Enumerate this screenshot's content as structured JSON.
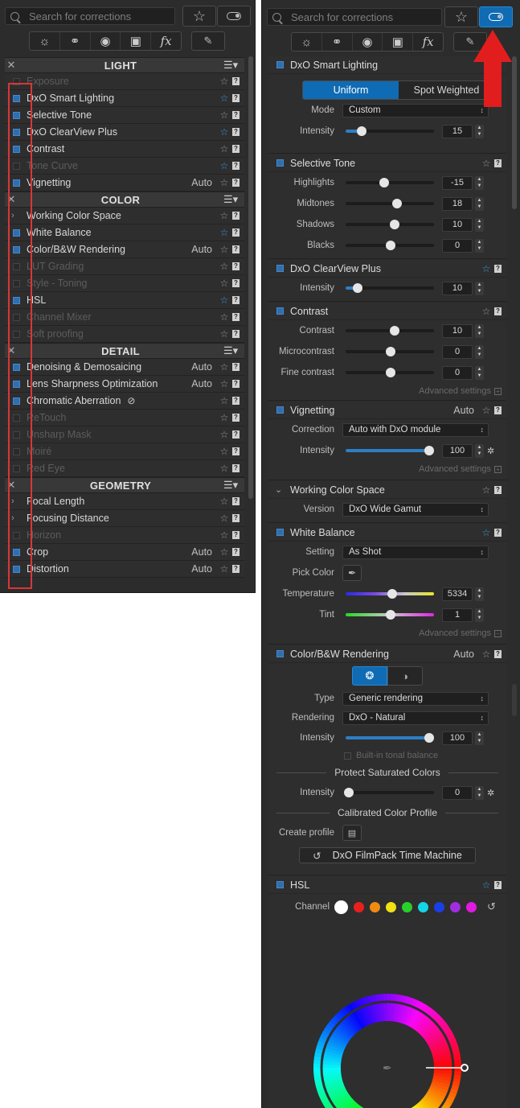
{
  "left": {
    "search_placeholder": "Search for corrections",
    "sections": [
      {
        "title": "LIGHT",
        "rows": [
          {
            "label": "Exposure",
            "state": "off",
            "dim": true,
            "auto": "",
            "star": false
          },
          {
            "label": "DxO Smart Lighting",
            "state": "on",
            "dim": false,
            "auto": "",
            "star": true
          },
          {
            "label": "Selective Tone",
            "state": "on",
            "dim": false,
            "auto": "",
            "star": false
          },
          {
            "label": "DxO ClearView Plus",
            "state": "on",
            "dim": false,
            "auto": "",
            "star": true
          },
          {
            "label": "Contrast",
            "state": "on",
            "dim": false,
            "auto": "",
            "star": false
          },
          {
            "label": "Tone Curve",
            "state": "off",
            "dim": true,
            "auto": "",
            "star": true
          },
          {
            "label": "Vignetting",
            "state": "on",
            "dim": false,
            "auto": "Auto",
            "star": false
          }
        ]
      },
      {
        "title": "COLOR",
        "rows": [
          {
            "label": "Working Color Space",
            "state": "chev",
            "dim": false,
            "auto": "",
            "star": false
          },
          {
            "label": "White Balance",
            "state": "on",
            "dim": false,
            "auto": "",
            "star": true
          },
          {
            "label": "Color/B&W Rendering",
            "state": "on",
            "dim": false,
            "auto": "Auto",
            "star": false
          },
          {
            "label": "LUT Grading",
            "state": "off",
            "dim": true,
            "auto": "",
            "star": false
          },
          {
            "label": "Style - Toning",
            "state": "off",
            "dim": true,
            "auto": "",
            "star": false
          },
          {
            "label": "HSL",
            "state": "on",
            "dim": false,
            "auto": "",
            "star": true
          },
          {
            "label": "Channel Mixer",
            "state": "off",
            "dim": true,
            "auto": "",
            "star": false
          },
          {
            "label": "Soft proofing",
            "state": "off",
            "dim": true,
            "auto": "",
            "star": false
          }
        ]
      },
      {
        "title": "DETAIL",
        "rows": [
          {
            "label": "Denoising & Demosaicing",
            "state": "on",
            "dim": false,
            "auto": "Auto",
            "star": false
          },
          {
            "label": "Lens Sharpness Optimization",
            "state": "on",
            "dim": false,
            "auto": "Auto",
            "star": false
          },
          {
            "label": "Chromatic Aberration",
            "state": "on",
            "dim": false,
            "auto": "",
            "star": false,
            "eye": true
          },
          {
            "label": "ReTouch",
            "state": "off",
            "dim": true,
            "auto": "",
            "star": false
          },
          {
            "label": "Unsharp Mask",
            "state": "off",
            "dim": true,
            "auto": "",
            "star": false
          },
          {
            "label": "Moiré",
            "state": "off",
            "dim": true,
            "auto": "",
            "star": false
          },
          {
            "label": "Red Eye",
            "state": "off",
            "dim": true,
            "auto": "",
            "star": false
          }
        ]
      },
      {
        "title": "GEOMETRY",
        "rows": [
          {
            "label": "Focal Length",
            "state": "chev",
            "dim": false,
            "auto": "",
            "star": false
          },
          {
            "label": "Focusing Distance",
            "state": "chev",
            "dim": false,
            "auto": "",
            "star": false
          },
          {
            "label": "Horizon",
            "state": "off",
            "dim": true,
            "auto": "",
            "star": false
          },
          {
            "label": "Crop",
            "state": "on",
            "dim": false,
            "auto": "Auto",
            "star": false
          },
          {
            "label": "Distortion",
            "state": "on",
            "dim": false,
            "auto": "Auto",
            "star": false
          }
        ]
      }
    ]
  },
  "right": {
    "search_placeholder": "Search for corrections",
    "smart_lighting": {
      "title": "DxO Smart Lighting",
      "seg_a": "Uniform",
      "seg_b": "Spot Weighted",
      "mode_label": "Mode",
      "mode_value": "Custom",
      "intensity_label": "Intensity",
      "intensity": "15"
    },
    "selective_tone": {
      "title": "Selective Tone",
      "rows": [
        {
          "label": "Highlights",
          "value": "-15"
        },
        {
          "label": "Midtones",
          "value": "18"
        },
        {
          "label": "Shadows",
          "value": "10"
        },
        {
          "label": "Blacks",
          "value": "0"
        }
      ]
    },
    "clearview": {
      "title": "DxO ClearView Plus",
      "intensity_label": "Intensity",
      "intensity": "10"
    },
    "contrast": {
      "title": "Contrast",
      "rows": [
        {
          "label": "Contrast",
          "value": "10"
        },
        {
          "label": "Microcontrast",
          "value": "0"
        },
        {
          "label": "Fine contrast",
          "value": "0"
        }
      ],
      "advanced": "Advanced settings"
    },
    "vignetting": {
      "title": "Vignetting",
      "auto": "Auto",
      "correction_label": "Correction",
      "correction_value": "Auto with DxO module",
      "intensity_label": "Intensity",
      "intensity": "100",
      "advanced": "Advanced settings"
    },
    "wcs": {
      "title": "Working Color Space",
      "version_label": "Version",
      "version_value": "DxO Wide Gamut"
    },
    "wb": {
      "title": "White Balance",
      "setting_label": "Setting",
      "setting_value": "As Shot",
      "pick_label": "Pick Color",
      "temp_label": "Temperature",
      "temp": "5334",
      "tint_label": "Tint",
      "tint": "1",
      "advanced": "Advanced settings"
    },
    "cbw": {
      "title": "Color/B&W Rendering",
      "auto": "Auto",
      "type_label": "Type",
      "type_value": "Generic rendering",
      "rendering_label": "Rendering",
      "rendering_value": "DxO - Natural",
      "intensity_label": "Intensity",
      "intensity": "100",
      "builtin": "Built-in tonal balance",
      "protect_title": "Protect Saturated Colors",
      "protect_label": "Intensity",
      "protect_value": "0",
      "calib_title": "Calibrated Color Profile",
      "create_label": "Create profile",
      "filmpack": "DxO FilmPack Time Machine"
    },
    "hsl": {
      "title": "HSL",
      "channel_label": "Channel",
      "swatches": [
        "#ffffff",
        "#e8201c",
        "#f08a12",
        "#f0e014",
        "#28d12a",
        "#12d6e6",
        "#1a3fe6",
        "#a12de0",
        "#e01ae0"
      ]
    }
  },
  "colors": {
    "accent": "#0f6bb3",
    "highlight_box": "#d93636",
    "arrow": "#e21d1d"
  }
}
